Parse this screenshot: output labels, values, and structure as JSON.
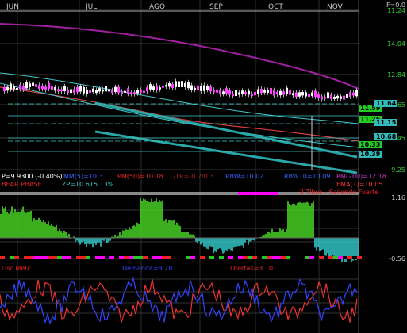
{
  "months": [
    "JUN",
    "JUL",
    "AGO",
    "SEP",
    "OCT",
    "NOV"
  ],
  "price_axis": {
    "labels": [
      "F=0.0",
      "11.24",
      "14.04",
      "12.84",
      "11.65",
      "10.45",
      "9.25"
    ]
  },
  "price_tags": {
    "green": [
      "11.59",
      "11.26",
      "10.33"
    ],
    "cyan": [
      "11.64",
      "11.15",
      "10.68",
      "10.39"
    ]
  },
  "indicators": {
    "price": "P=9.9300 (-0.40%)",
    "mm": "MM(5)=10.3",
    "pm50": "PM(50)=10.18",
    "lt": "L/TR=-0.2/0.3",
    "rbw": "RBW=10.02",
    "rbw10": "RBW10=10.09",
    "pm200": "PM(200)=12.18",
    "phase": "BEAR PHASE",
    "zp": "ZP=10.61",
    "zp_pct": "5.13%",
    "ema": "EMA(1)=10.05"
  },
  "osc1": {
    "title": "2 Tibus - Saliendo Fuerte",
    "max": "1.16",
    "min": "-0.56"
  },
  "osc2": {
    "oscmerc": "Osc Merc",
    "demanda": "Demanda=8.28",
    "ofertas": "Ofertas=3.10"
  },
  "colors": {
    "background": "#000000",
    "grid": "#2e2e2e",
    "ma200": "#a020a0",
    "ma50": "#d04040",
    "cyan_band": "#40c8c8",
    "candle_up": "#ffffff",
    "candle_down": "#ff40ff",
    "osc_green": "#44cc22",
    "osc_cyan": "#33cccc",
    "demand_line": "#3344ff",
    "offer_line": "#ee3333"
  }
}
